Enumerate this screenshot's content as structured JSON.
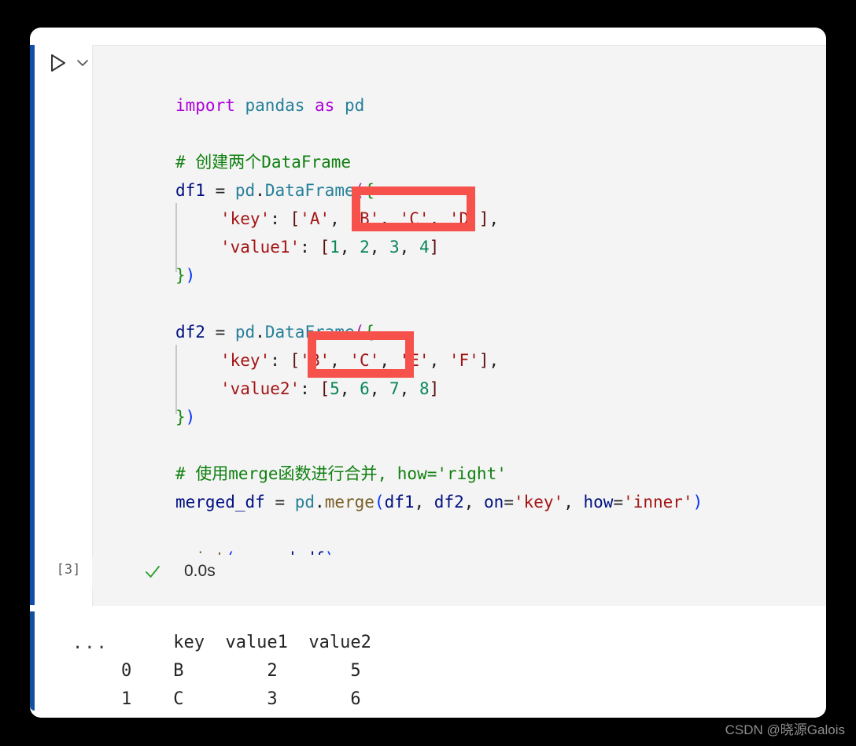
{
  "window": {
    "background_color": "#000000",
    "card_background": "#ffffff"
  },
  "cell": {
    "focus_bar_color": "#0f4fa8",
    "run_button_label": "run-cell",
    "chevron_label": "more-actions",
    "execution_count": "[3]",
    "execution_time": "0.0s",
    "status": "success",
    "check_color": "#2e9e2e",
    "editor_background": "#f4f4f4"
  },
  "code": {
    "language": "python",
    "lines": [
      "import pandas as pd",
      "",
      "# 创建两个DataFrame",
      "df1 = pd.DataFrame({",
      "    'key': ['A', 'B', 'C', 'D'],",
      "    'value1': [1, 2, 3, 4]",
      "})",
      "",
      "df2 = pd.DataFrame({",
      "    'key': ['B', 'C', 'E', 'F'],",
      "    'value2': [5, 6, 7, 8]",
      "})",
      "",
      "# 使用merge函数进行合并, how='right'",
      "merged_df = pd.merge(df1, df2, on='key', how='inner')",
      "",
      "print(merged_df)"
    ],
    "tokens": {
      "l1": {
        "kw_import": "import",
        "mod_pandas": "pandas",
        "kw_as": "as",
        "mod_pd": "pd"
      },
      "l3": {
        "comment": "# 创建两个DataFrame"
      },
      "l4": {
        "var": "df1",
        "op": " = ",
        "mod": "pd",
        "dot": ".",
        "cls": "DataFrame",
        "paren": "(",
        "brace": "{"
      },
      "l5": {
        "bracket_open": "    ",
        "key": "'key'",
        "colon": ": ",
        "lb": "[",
        "a": "'A'",
        "c1": ", ",
        "b": "'B'",
        "c2": ", ",
        "c": "'C'",
        "c3": ", ",
        "d": "'D'",
        "rb": "]",
        "c4": ","
      },
      "l6": {
        "key": "'value1'",
        "colon": ": ",
        "lb": "[",
        "n1": "1",
        "n2": "2",
        "n3": "3",
        "n4": "4",
        "rb": "]"
      },
      "l7": {
        "brace": "}",
        "paren": ")"
      },
      "l9": {
        "var": "df2",
        "op": " = ",
        "mod": "pd",
        "dot": ".",
        "cls": "DataFrame",
        "paren": "(",
        "brace": "{"
      },
      "l10": {
        "key": "'key'",
        "colon": ": ",
        "lb": "[",
        "b": "'B'",
        "c": "'C'",
        "e": "'E'",
        "f": "'F'",
        "rb": "]",
        "comma": ","
      },
      "l11": {
        "key": "'value2'",
        "colon": ": ",
        "lb": "[",
        "n1": "5",
        "n2": "6",
        "n3": "7",
        "n4": "8",
        "rb": "]"
      },
      "l12": {
        "brace": "}",
        "paren": ")"
      },
      "l14": {
        "comment": "# 使用merge函数进行合并, how='right'"
      },
      "l15": {
        "var": "merged_df",
        "op": " = ",
        "mod": "pd",
        "dot": ".",
        "fn": "merge",
        "paren": "(",
        "a1": "df1",
        "c1": ", ",
        "a2": "df2",
        "c2": ", ",
        "kw_on": "on",
        "eq1": "=",
        "v_on": "'key'",
        "c3": ", ",
        "kw_how": "how",
        "eq2": "=",
        "v_how": "'inner'",
        "rparen": ")"
      },
      "l17": {
        "fn": "print",
        "paren": "(",
        "arg": "merged_df",
        "rparen": ")"
      }
    }
  },
  "annotations": [
    {
      "name": "highlight-df1-keys",
      "color": "#f7514c",
      "covers": "'B', 'C',"
    },
    {
      "name": "highlight-df2-keys",
      "color": "#f7514c",
      "covers": "'B', 'C'"
    }
  ],
  "output": {
    "prefix": "...",
    "header": "     key  value1  value2",
    "rows": [
      "0    B        2       5",
      "1    C        3       6"
    ],
    "full_text": "     key  value1  value2\n0    B        2       5\n1    C        3       6",
    "table": {
      "columns": [
        "",
        "key",
        "value1",
        "value2"
      ],
      "data": [
        [
          "0",
          "B",
          "2",
          "5"
        ],
        [
          "1",
          "C",
          "3",
          "6"
        ]
      ]
    }
  },
  "watermark": {
    "text": "CSDN @晓源Galois"
  }
}
